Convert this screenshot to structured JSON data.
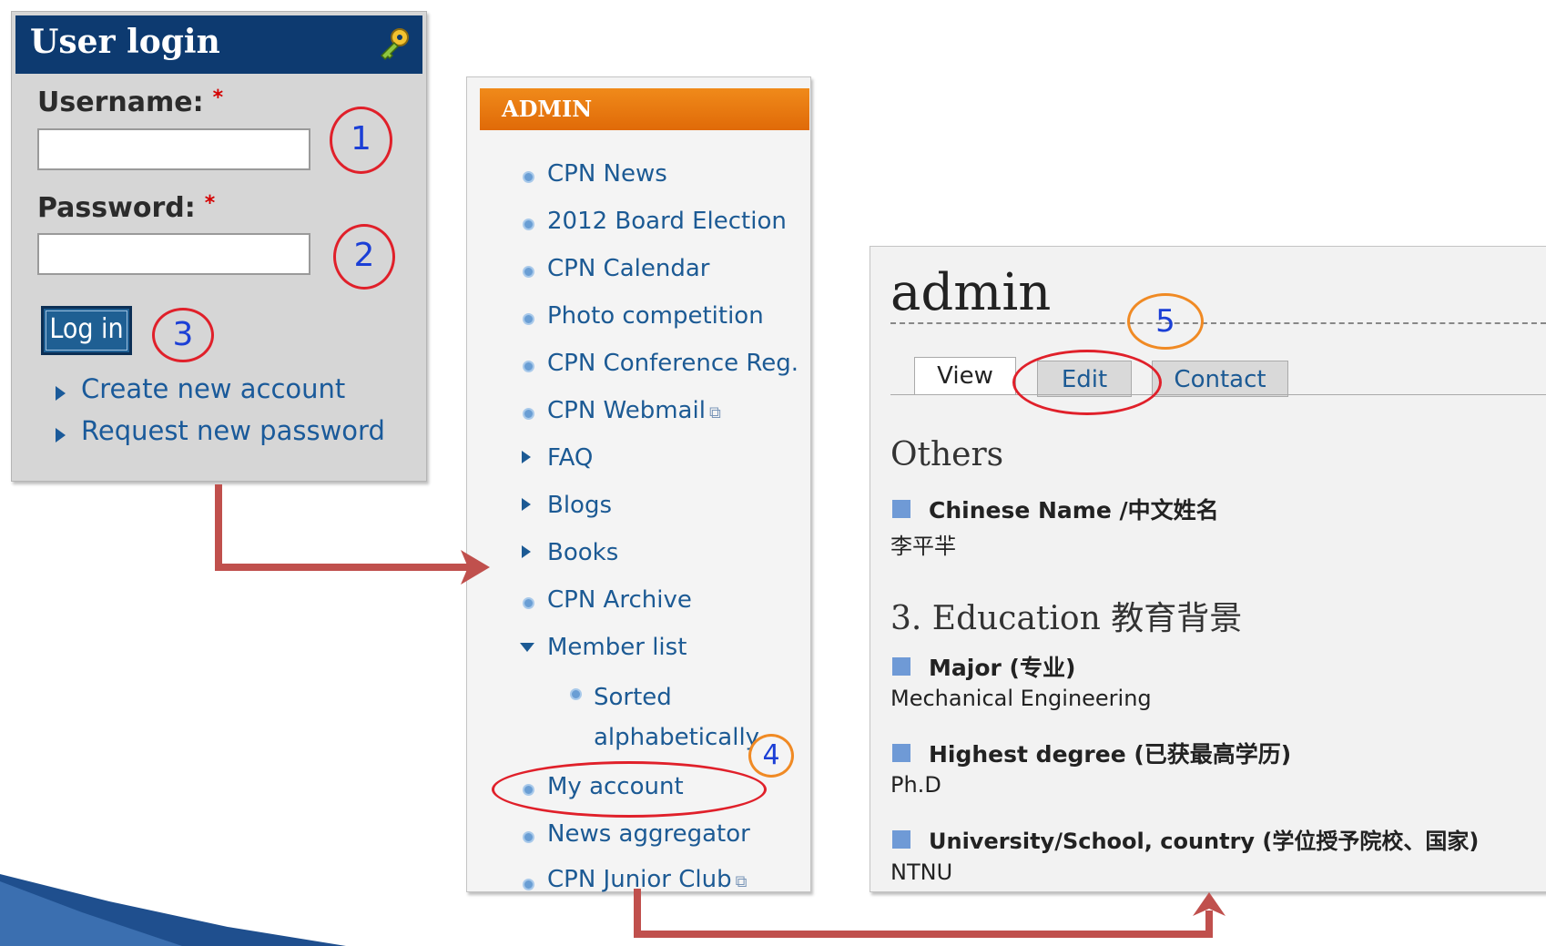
{
  "login": {
    "title": "User login",
    "username_label": "Username:",
    "password_label": "Password:",
    "required_mark": "*",
    "login_button": "Log in",
    "links": [
      "Create new account",
      "Request new password"
    ],
    "icon": "key-icon"
  },
  "admin_menu": {
    "header": "ADMIN",
    "items": [
      {
        "label": "CPN News",
        "marker": "bullet"
      },
      {
        "label": "2012 Board Election",
        "marker": "bullet"
      },
      {
        "label": "CPN Calendar",
        "marker": "bullet"
      },
      {
        "label": "Photo competition",
        "marker": "bullet"
      },
      {
        "label": "CPN Conference Reg.",
        "marker": "bullet"
      },
      {
        "label": "CPN Webmail",
        "marker": "bullet",
        "external": true
      },
      {
        "label": "FAQ",
        "marker": "collapsed"
      },
      {
        "label": "Blogs",
        "marker": "collapsed"
      },
      {
        "label": "Books",
        "marker": "collapsed"
      },
      {
        "label": "CPN Archive",
        "marker": "bullet"
      },
      {
        "label": "Member list",
        "marker": "expanded"
      },
      {
        "label": "Sorted alphabetically",
        "marker": "bullet",
        "child": true
      },
      {
        "label": "My account",
        "marker": "bullet"
      },
      {
        "label": "News aggregator",
        "marker": "bullet"
      },
      {
        "label": "CPN Junior Club",
        "marker": "bullet",
        "external": true
      }
    ],
    "sub_item_lines": [
      "Sorted",
      "alphabetically"
    ]
  },
  "profile": {
    "title": "admin",
    "tabs": [
      "View",
      "Edit",
      "Contact"
    ],
    "active_tab": "View",
    "section_others": "Others",
    "chinese_name_label": "Chinese Name /中文姓名",
    "chinese_name_value": "李平羋",
    "section_education": "3. Education 教育背景",
    "major_label": "Major (专业)",
    "major_value": "Mechanical Engineering",
    "degree_label": "Highest degree (已获最高学历)",
    "degree_value": "Ph.D",
    "university_label": "University/School, country (学位授予院校、国家)",
    "university_value": "NTNU"
  },
  "annotations": {
    "step_numbers": [
      "1",
      "2",
      "3",
      "4",
      "5"
    ],
    "colors": {
      "red": "#e0202a",
      "orange": "#f08a24",
      "number_blue": "#1b3fd6",
      "arrow": "#c0504d"
    }
  },
  "colors": {
    "login_header": "#0d3a70",
    "admin_header": "#e87810",
    "link_blue": "#1c5a94",
    "field_square": "#6f9ad6"
  }
}
